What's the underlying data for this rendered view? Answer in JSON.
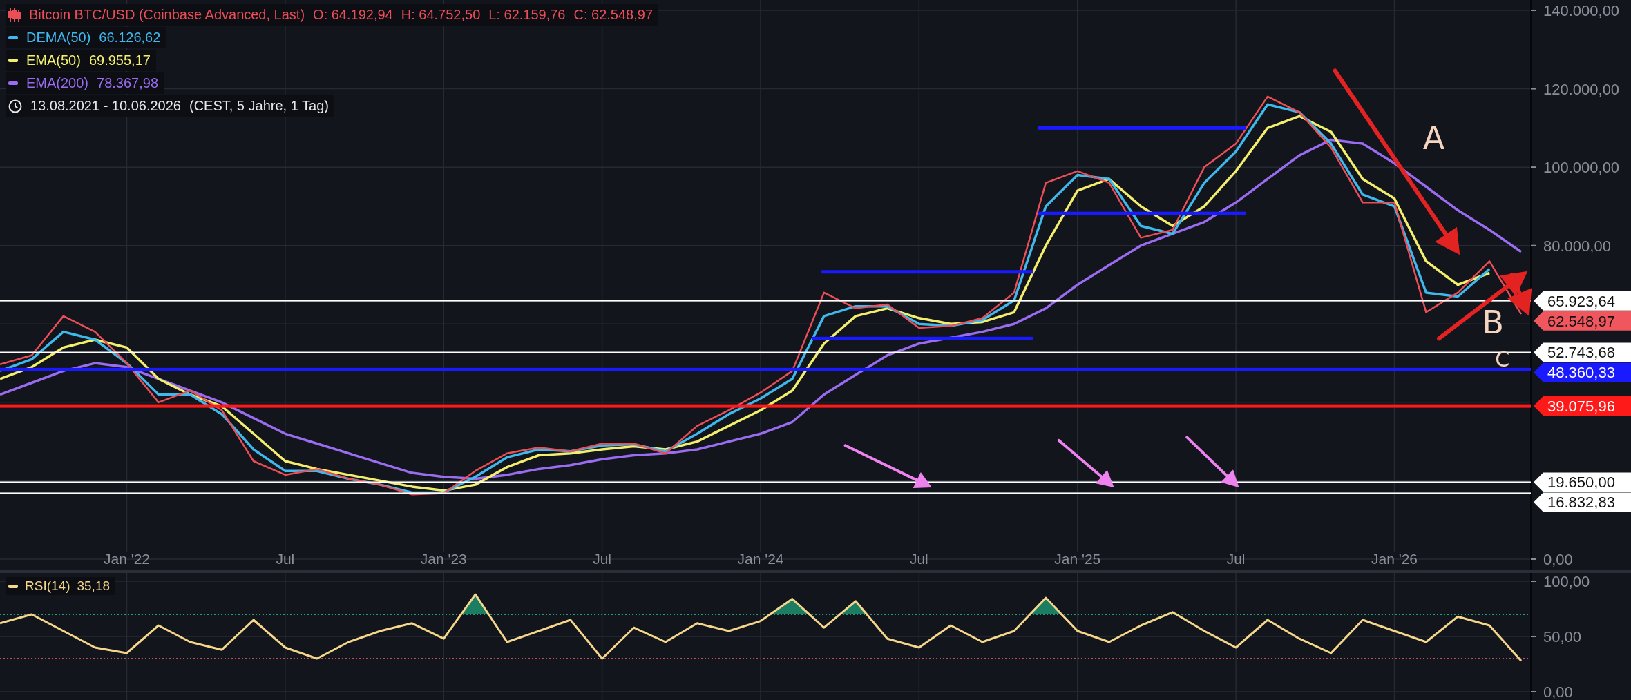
{
  "legend": {
    "ohlc": [
      "O: 64.192,94",
      "H: 64.752,50",
      "L: 62.159,76",
      "C: 62.548,97"
    ],
    "indicator_values": [
      "66.126,62",
      "69.955,17",
      "78.367,98"
    ],
    "range": {
      "dates": "13.08.2021 - 10.06.2026",
      "details": "(CEST, 5 Jahre, 1 Tag)"
    }
  },
  "price_chart": {
    "chart_data": {
      "type": "line",
      "grid": true,
      "ylim": [
        0,
        140000
      ],
      "categories": [
        null,
        null,
        null,
        null,
        "Jan '22",
        null,
        null,
        null,
        null,
        "Jul",
        null,
        null,
        null,
        null,
        "Jan '23",
        null,
        null,
        null,
        null,
        "Jul",
        null,
        null,
        null,
        null,
        "Jan '24",
        null,
        null,
        null,
        null,
        "Jul",
        null,
        null,
        null,
        null,
        "Jan '25",
        null,
        null,
        null,
        null,
        "Jul",
        null,
        null,
        null,
        null,
        "Jan '26",
        null,
        null,
        null,
        null
      ],
      "yticks": [
        {
          "value": 0,
          "label": "0,00"
        },
        {
          "value": 80000,
          "label": "80.000,00"
        },
        {
          "value": 100000,
          "label": "100.000,00"
        },
        {
          "value": 120000,
          "label": "120.000,00"
        },
        {
          "value": 140000,
          "label": "140.000,00"
        }
      ],
      "series": [
        {
          "name": "Bitcoin BTC/USD (Coinbase Advanced, Last)",
          "color": "#ec4e57",
          "values": [
            49700,
            52000,
            62000,
            58000,
            50000,
            40000,
            43000,
            38000,
            25000,
            21500,
            23000,
            20500,
            19000,
            16500,
            16800,
            22500,
            27000,
            28500,
            27500,
            29500,
            29500,
            27000,
            34000,
            38000,
            42500,
            48000,
            68000,
            64000,
            65000,
            59000,
            59500,
            61500,
            68000,
            96000,
            99000,
            96000,
            82000,
            84000,
            100000,
            106000,
            118000,
            114000,
            105000,
            91000,
            91000,
            63000,
            68000,
            76000,
            62500
          ]
        },
        {
          "name": "DEMA(50)",
          "color": "#3fb8ec",
          "values": [
            48000,
            51000,
            58000,
            56000,
            50000,
            42000,
            42000,
            37000,
            28000,
            22500,
            22500,
            20500,
            19000,
            17000,
            17000,
            21000,
            26000,
            28000,
            27500,
            29000,
            29300,
            27500,
            32000,
            37000,
            41000,
            46000,
            62000,
            64500,
            64500,
            60000,
            59500,
            61000,
            66000,
            90000,
            98000,
            97000,
            85000,
            83000,
            96000,
            104000,
            116000,
            114000,
            106000,
            93000,
            90000,
            68000,
            67000,
            74000,
            null
          ]
        },
        {
          "name": "EMA(50)",
          "color": "#f3ef6c",
          "values": [
            46000,
            49000,
            54000,
            56000,
            54000,
            46000,
            42000,
            39000,
            32000,
            25000,
            23000,
            21500,
            20000,
            18500,
            17500,
            19000,
            23500,
            26500,
            27000,
            28000,
            28800,
            28000,
            30000,
            34000,
            38000,
            43000,
            55000,
            62000,
            64000,
            61500,
            60000,
            60500,
            63000,
            80000,
            94000,
            97000,
            90000,
            85000,
            90000,
            99000,
            110000,
            113000,
            109000,
            97000,
            92000,
            76000,
            70000,
            73000,
            null
          ]
        },
        {
          "name": "EMA(200)",
          "color": "#9a6cf0",
          "values": [
            42000,
            45000,
            48000,
            50000,
            49000,
            46000,
            43000,
            40000,
            36000,
            32000,
            29500,
            27000,
            24500,
            22000,
            21000,
            20500,
            21500,
            23000,
            24000,
            25500,
            26500,
            27000,
            28000,
            30000,
            32000,
            35000,
            42000,
            47000,
            52000,
            55000,
            56500,
            58000,
            60000,
            64000,
            70000,
            75000,
            80000,
            83000,
            86000,
            91000,
            97000,
            103000,
            107000,
            106000,
            101000,
            95000,
            89000,
            84000,
            78400
          ]
        }
      ],
      "annotations": [
        "A",
        "B",
        "C"
      ]
    },
    "price_lines": [
      {
        "label": "65.923,64",
        "color": "#ffffff"
      },
      {
        "label": "52.743,68",
        "color": "#ffffff"
      },
      {
        "label": "48.360,33",
        "color": "#1a1aff"
      },
      {
        "label": "39.075,96",
        "color": "#ff1a1a"
      },
      {
        "label": "19.650,00",
        "color": "#ffffff"
      },
      {
        "label": "16.832,83",
        "color": "#ffffff"
      }
    ],
    "drawings": [
      {
        "kind": "segment",
        "color": "#1a1aff"
      },
      {
        "kind": "segment",
        "color": "#1a1aff"
      },
      {
        "kind": "segment",
        "color": "#1a1aff"
      },
      {
        "kind": "segment",
        "color": "#1a1aff"
      },
      {
        "kind": "arrow",
        "color": "#e32222"
      },
      {
        "kind": "arrow",
        "color": "#e32222"
      },
      {
        "kind": "arrow",
        "color": "#e32222"
      },
      {
        "kind": "arrow",
        "color": "#ee82ee"
      },
      {
        "kind": "arrow",
        "color": "#ee82ee"
      },
      {
        "kind": "arrow",
        "color": "#ee82ee"
      }
    ],
    "price_labels": [
      {
        "text": "62.548,97",
        "color": "#f0565e"
      }
    ]
  },
  "rsi": {
    "value": "35,18",
    "chart_data": {
      "type": "line",
      "grid": true,
      "ylim": [
        0,
        100
      ],
      "categories": [
        null,
        null,
        null,
        null,
        null,
        null,
        null,
        null,
        null,
        null,
        null,
        null,
        null,
        null,
        null,
        null,
        null,
        null,
        null,
        null,
        null,
        null,
        null,
        null,
        null,
        null,
        null,
        null,
        null,
        null,
        null,
        null,
        null,
        null,
        null,
        null,
        null,
        null,
        null,
        null,
        null,
        null,
        null,
        null,
        null,
        null,
        null,
        null,
        null
      ],
      "yticks": [
        {
          "value": 0,
          "label": "0,00"
        },
        {
          "value": 50,
          "label": "50,00"
        },
        {
          "value": 100,
          "label": "100,00"
        }
      ],
      "series": [
        {
          "name": "RSI(14)",
          "color": "#f5d68a",
          "values": [
            62,
            70,
            55,
            40,
            35,
            60,
            45,
            38,
            65,
            40,
            30,
            45,
            55,
            62,
            48,
            88,
            45,
            55,
            65,
            30,
            58,
            45,
            62,
            55,
            64,
            84,
            58,
            82,
            48,
            40,
            60,
            45,
            55,
            85,
            55,
            45,
            60,
            72,
            55,
            40,
            65,
            48,
            35,
            65,
            55,
            45,
            68,
            60,
            28
          ]
        }
      ]
    }
  }
}
